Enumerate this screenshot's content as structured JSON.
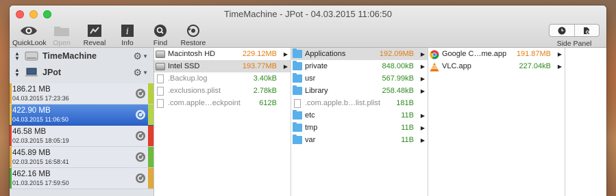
{
  "window": {
    "title": "TimeMachine - JPot - 04.03.2015 11:06:50"
  },
  "toolbar": {
    "quicklook": "QuickLook",
    "open": "Open",
    "reveal": "Reveal",
    "info": "Info",
    "find": "Find",
    "restore": "Restore",
    "side_panel": "Side Panel"
  },
  "sidebar": {
    "volumes": [
      {
        "name": "TimeMachine",
        "icon": "drive-icon"
      },
      {
        "name": "JPot",
        "icon": "laptop-icon"
      }
    ],
    "snapshots": [
      {
        "size": "186.21 MB",
        "date": "04.03.2015 17:23:36",
        "bar_color": "#b7cf3a",
        "left_color": "#e1a83a"
      },
      {
        "size": "422.90 MB",
        "date": "04.03.2015 11:06:50",
        "bar_color": "#b6d34a",
        "left_color": "#f0c040",
        "selected": true
      },
      {
        "size": "46.58 MB",
        "date": "02.03.2015 18:05:19",
        "bar_color": "#e33b2e",
        "left_color": "#e33b2e"
      },
      {
        "size": "445.89 MB",
        "date": "02.03.2015 16:58:41",
        "bar_color": "#6dbb3e",
        "left_color": "#e1a83a"
      },
      {
        "size": "462.16 MB",
        "date": "01.03.2015 17:59:50",
        "bar_color": "#e1a83a",
        "left_color": "#4aa83a"
      }
    ]
  },
  "columns": {
    "col1": [
      {
        "name": "Macintosh HD",
        "size": "229.12MB",
        "color": "orange",
        "arrow": true,
        "icon": "disk",
        "hl": false
      },
      {
        "name": "Intel SSD",
        "size": "193.77MB",
        "color": "orange",
        "arrow": true,
        "icon": "disk",
        "hl": true
      },
      {
        "name": ".Backup.log",
        "size": "3.40kB",
        "color": "green",
        "arrow": false,
        "icon": "doc",
        "dim": true
      },
      {
        "name": ".exclusions.plist",
        "size": "2.78kB",
        "color": "green",
        "arrow": false,
        "icon": "doc",
        "dim": true
      },
      {
        "name": ".com.apple…eckpoint",
        "size": "612B",
        "color": "green",
        "arrow": false,
        "icon": "doc",
        "dim": true
      }
    ],
    "col2": [
      {
        "name": "Applications",
        "size": "192.09MB",
        "color": "orange",
        "arrow": true,
        "icon": "folder",
        "hl": true
      },
      {
        "name": "private",
        "size": "848.00kB",
        "color": "green",
        "arrow": true,
        "icon": "folder"
      },
      {
        "name": "usr",
        "size": "567.99kB",
        "color": "green",
        "arrow": true,
        "icon": "folder"
      },
      {
        "name": "Library",
        "size": "258.48kB",
        "color": "green",
        "arrow": true,
        "icon": "folder"
      },
      {
        "name": ".com.apple.b…list.plist",
        "size": "181B",
        "color": "green",
        "arrow": false,
        "icon": "doc",
        "dim": true
      },
      {
        "name": "etc",
        "size": "11B",
        "color": "green",
        "arrow": true,
        "icon": "folder"
      },
      {
        "name": "tmp",
        "size": "11B",
        "color": "green",
        "arrow": true,
        "icon": "folder"
      },
      {
        "name": "var",
        "size": "11B",
        "color": "green",
        "arrow": true,
        "icon": "folder"
      }
    ],
    "col3": [
      {
        "name": "Google C…me.app",
        "size": "191.87MB",
        "color": "orange",
        "arrow": true,
        "icon": "chrome"
      },
      {
        "name": "VLC.app",
        "size": "227.04kB",
        "color": "green",
        "arrow": true,
        "icon": "vlc"
      }
    ]
  }
}
